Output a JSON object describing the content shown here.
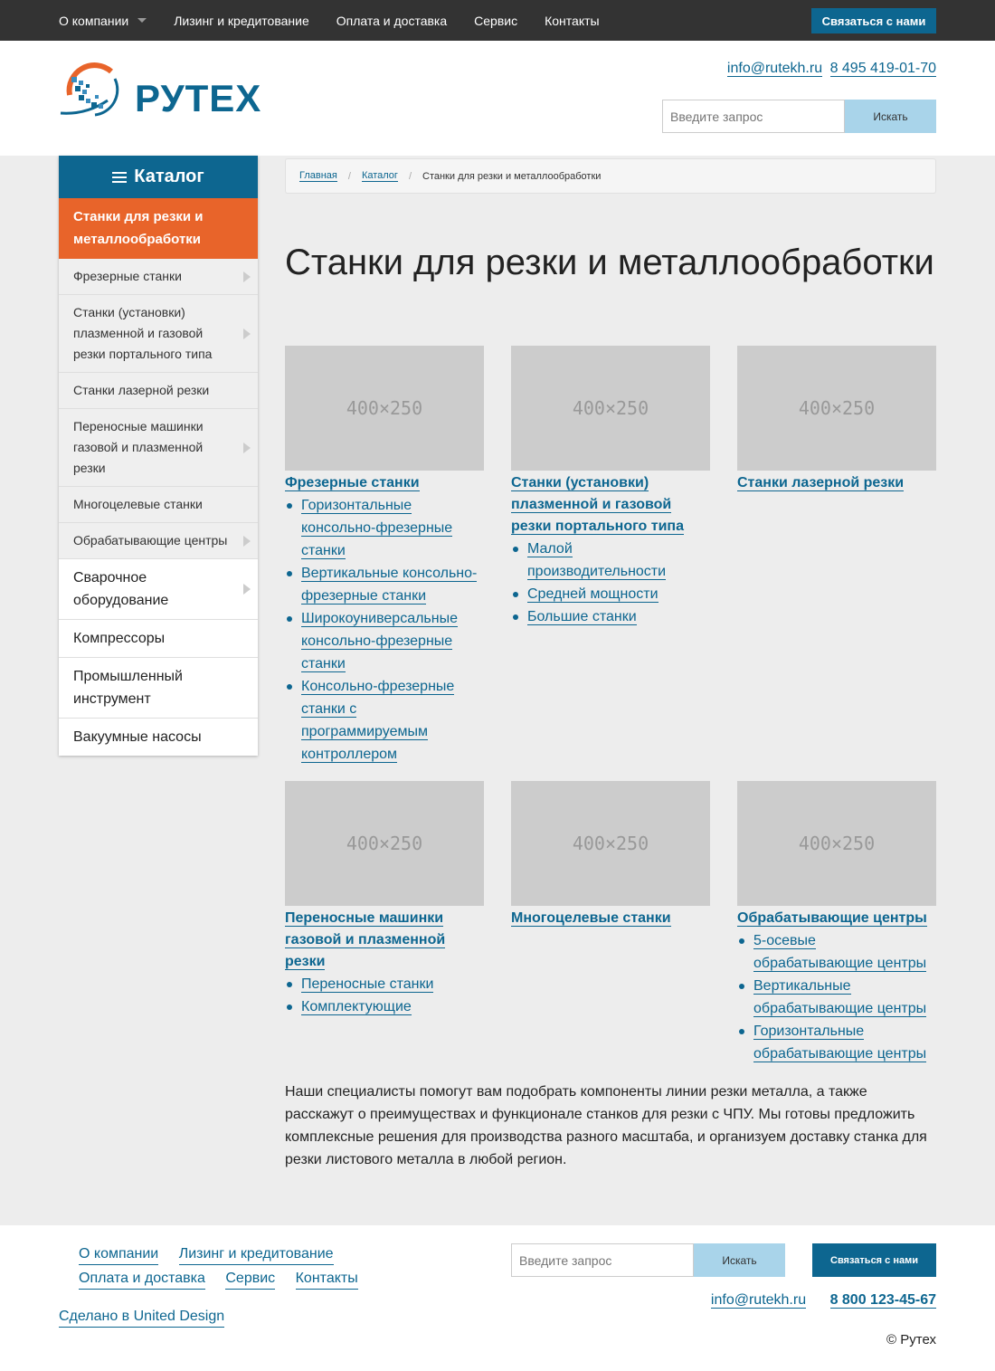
{
  "topnav": {
    "items": [
      "О компании",
      "Лизинг и кредитование",
      "Оплата и доставка",
      "Сервис",
      "Контакты"
    ],
    "contact_button": "Связаться с нами"
  },
  "header": {
    "logo_text": "РУТЕХ",
    "email": "info@rutekh.ru",
    "phone": "8 495 419-01-70",
    "search_placeholder": "Введите запрос",
    "search_button": "Искать"
  },
  "sidebar": {
    "title": "Каталог",
    "active": "Станки для резки и металлообработки",
    "sub_items": [
      "Фрезерные станки",
      "Станки (установки) плазменной и газовой резки портального типа",
      "Станки лазерной резки",
      "Переносные машинки газовой и плазменной резки",
      "Многоцелевые станки",
      "Обрабатывающие центры"
    ],
    "main_items": [
      "Сварочное оборудование",
      "Компрессоры",
      "Промышленный инструмент",
      "Вакуумные насосы"
    ]
  },
  "breadcrumb": {
    "home": "Главная",
    "catalog": "Каталог",
    "current": "Станки для резки и металлообработки"
  },
  "page": {
    "title": "Станки для резки и металлообработки",
    "placeholder_label": "400×250",
    "cards": [
      {
        "title": "Фрезерные станки",
        "items": [
          "Горизонтальные консольно-фрезерные станки",
          "Вертикальные консольно-фрезерные станки",
          "Широкоуниверсальные консольно-фрезерные станки",
          "Консольно-фрезерные станки с программируемым контроллером"
        ]
      },
      {
        "title": "Станки (установки) плазменной и газовой резки портального типа",
        "items": [
          "Малой производительности",
          "Средней мощности",
          "Большие станки"
        ]
      },
      {
        "title": "Станки лазерной резки",
        "items": []
      },
      {
        "title": "Переносные машинки газовой и плазменной резки",
        "items": [
          "Переносные станки",
          "Комплектующие"
        ]
      },
      {
        "title": "Многоцелевые станки",
        "items": []
      },
      {
        "title": "Обрабатывающие центры",
        "items": [
          "5-осевые обрабатывающие центры",
          "Вертикальные обрабатывающие центры",
          "Горизонтальные обрабатывающие центры"
        ]
      }
    ],
    "description": "Наши специалисты помогут вам подобрать компоненты линии резки металла, а также расскажут о преимуществах и функционале станков для резки с ЧПУ. Мы готовы предложить комплексные решения для производства разного масштаба, и организуем доставку станка для резки листового металла в любой регион."
  },
  "footer": {
    "links": [
      "О компании",
      "Лизинг и кредитование",
      "Оплата и доставка",
      "Сервис",
      "Контакты"
    ],
    "made_by": "Сделано в United Design",
    "search_placeholder": "Введите запрос",
    "search_button": "Искать",
    "contact_button": "Связаться с нами",
    "email": "info@rutekh.ru",
    "phone": "8 800 123-45-67",
    "copyright": "© Рутех"
  },
  "colors": {
    "brand_blue": "#0d6690",
    "accent_orange": "#e8642a",
    "topbar": "#333333",
    "search_button": "#a9d4ea"
  }
}
